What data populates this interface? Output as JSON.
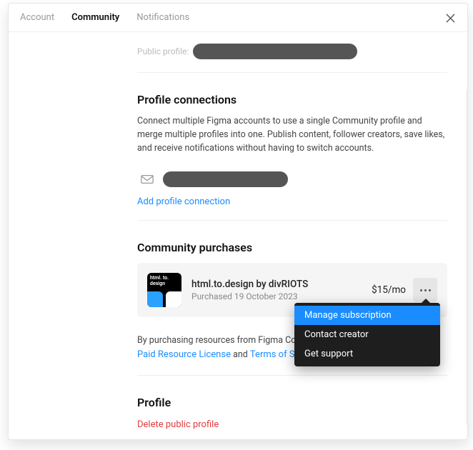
{
  "tabs": {
    "account": "Account",
    "community": "Community",
    "notifications": "Notifications"
  },
  "publicProfile": {
    "label": "Public profile:"
  },
  "connections": {
    "heading": "Profile connections",
    "desc": "Connect multiple Figma accounts to use a single Community profile and merge multiple profiles into one. Publish content, follower creators, save likes, and receive notifications without having to switch accounts.",
    "addLink": "Add profile connection"
  },
  "purchases": {
    "heading": "Community purchases",
    "item": {
      "title": "html.to.design by divRIOTS",
      "sub": "Purchased 19 October 2023",
      "price": "$15/mo",
      "thumbLabel": "html.\nto.\ndesign"
    },
    "note": {
      "prefix": "By purchasing resources from Figma Comm",
      "license": "Paid Resource License",
      "and": " and ",
      "tos": "Terms of Servic"
    }
  },
  "menu": {
    "manage": "Manage subscription",
    "contact": "Contact creator",
    "support": "Get support"
  },
  "profile": {
    "heading": "Profile",
    "delete": "Delete public profile"
  }
}
